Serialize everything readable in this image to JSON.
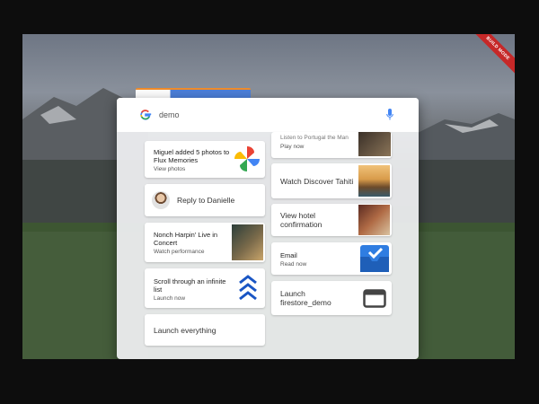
{
  "search": {
    "query": "demo"
  },
  "ribbon": {
    "text": "BUILD MODE"
  },
  "cards_left": [
    {
      "title": "Miguel added 5 photos to Flux Memories",
      "subtitle": "View photos",
      "icon": "pinwheel-photos-icon"
    },
    {
      "title": "Reply to Danielle",
      "icon": "avatar"
    },
    {
      "title": "Nonch Harpin' Live in Concert",
      "subtitle": "Watch performance",
      "icon": "concert-photo"
    },
    {
      "title": "Scroll through an infinite list",
      "subtitle": "Launch now",
      "icon": "chevrons-up-icon"
    },
    {
      "title": "Launch everything"
    }
  ],
  "cards_right": [
    {
      "title": "Listen to Portugal the Man",
      "subtitle": "Play now",
      "icon": "album-photo"
    },
    {
      "title": "Watch Discover Tahiti",
      "icon": "tahiti-photo"
    },
    {
      "title": "View hotel confirmation",
      "icon": "hotel-photo"
    },
    {
      "title": "Email",
      "subtitle": "Read now",
      "icon": "inbox-icon"
    },
    {
      "title": "Launch firestore_demo",
      "icon": "window-icon"
    }
  ],
  "colors": {
    "accent_blue": "#1a56c4",
    "inbox_blue": "#2f7de1",
    "ribbon_red": "#c62828"
  }
}
